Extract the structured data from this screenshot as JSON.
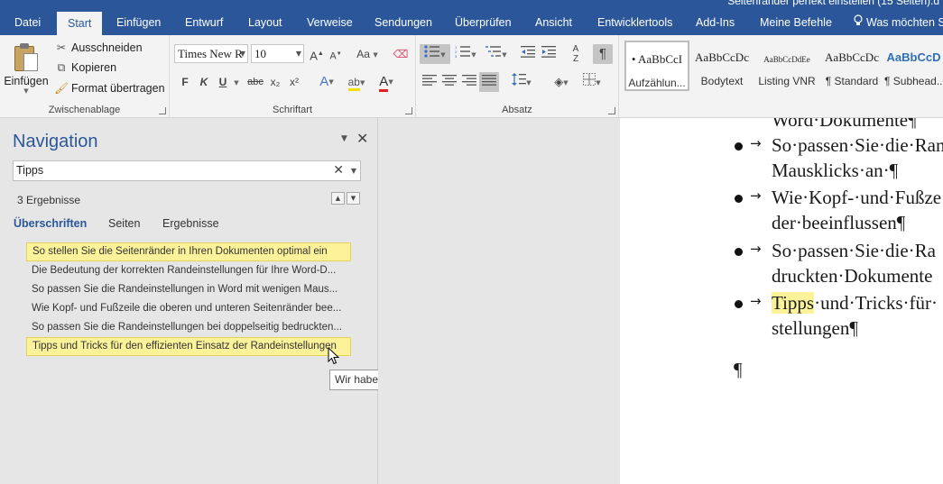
{
  "window": {
    "title_fragment": "Seitenränder perfekt einstellen (15 Seiten).d"
  },
  "tabs": [
    "Datei",
    "Start",
    "Einfügen",
    "Entwurf",
    "Layout",
    "Verweise",
    "Sendungen",
    "Überprüfen",
    "Ansicht",
    "Entwicklertools",
    "Add-Ins",
    "Meine Befehle"
  ],
  "tell_me": "Was möchten S",
  "clipboard": {
    "label": "Zwischenablage",
    "paste": "Einfügen",
    "cut": "Ausschneiden",
    "copy": "Kopieren",
    "format_painter": "Format übertragen"
  },
  "font": {
    "label": "Schriftart",
    "family": "Times New R",
    "size": "10",
    "bold": "F",
    "italic": "K",
    "underline": "U",
    "strike": "abc",
    "sub": "x₂",
    "sup": "x²",
    "case": "Aa",
    "grow": "A",
    "shrink": "A"
  },
  "paragraph": {
    "label": "Absatz"
  },
  "styles": [
    {
      "preview": "• AaBbCcI",
      "name": "Aufzählun..."
    },
    {
      "preview": "AaBbCcDc",
      "name": "Bodytext"
    },
    {
      "preview": "AaBbCcDdEe",
      "name": "Listing VNR"
    },
    {
      "preview": "AaBbCcDc",
      "name": "¶ Standard"
    },
    {
      "preview": "AaBbCcD",
      "name": "¶ Subhead..."
    }
  ],
  "navigation": {
    "title": "Navigation",
    "search_value": "Tipps",
    "result_count": "3 Ergebnisse",
    "tabs": [
      "Überschriften",
      "Seiten",
      "Ergebnisse"
    ],
    "headings": [
      {
        "text": "So stellen Sie die Seitenränder in Ihren Dokumenten optimal ein",
        "highlighted": true
      },
      {
        "text": "Die Bedeutung der korrekten Randeinstellungen für Ihre Word-D...",
        "highlighted": false
      },
      {
        "text": "So passen Sie die Randeinstellungen in Word mit wenigen Maus...",
        "highlighted": false
      },
      {
        "text": "Wie Kopf- und Fußzeile die oberen und unteren Seitenränder bee...",
        "highlighted": false
      },
      {
        "text": "So passen Sie die Randeinstellungen bei doppelseitig bedruckten...",
        "highlighted": false
      },
      {
        "text": "Tipps und Tricks für den effizienten Einsatz der Randeinstellungen",
        "highlighted": true
      }
    ],
    "tooltip": "Wir haben eine Übereinstimmung"
  },
  "document": {
    "lines": [
      "Word·Dokumente¶",
      "So·passen·Sie·die·Ran",
      "Mausklicks·an·¶",
      "Wie·Kopf-·und·Fußze",
      "der·beeinflussen¶",
      "So·passen·Sie·die·Ra",
      "druckten·Dokumente",
      "Tipps",
      "·und·Tricks·für·",
      "stellungen¶",
      "¶"
    ]
  },
  "colors": {
    "accent": "#2b579a",
    "search_hit": "#fcf29a"
  }
}
